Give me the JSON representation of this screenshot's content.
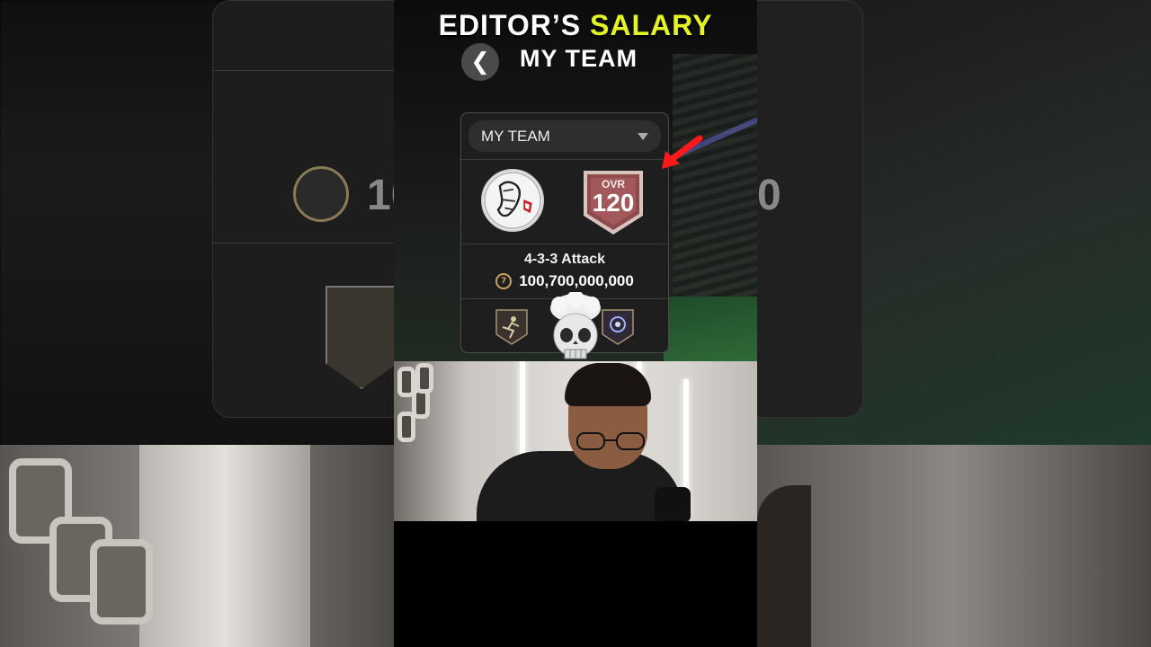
{
  "headline": {
    "part1": "EDITOR’S ",
    "part2": "SALARY"
  },
  "header": {
    "title": "MY TEAM",
    "back_glyph": "❮"
  },
  "card": {
    "dropdown_label": "MY TEAM",
    "ovr_label": "OVR",
    "ovr_value": "120",
    "formation": "4-3-3 Attack",
    "team_value": "100,700,000,000"
  },
  "background": {
    "left_value_fragment": "10",
    "right_value_fragment": "0"
  },
  "colors": {
    "accent_yellow": "#e6f322",
    "ovr_badge_red": "#8e4a4d",
    "arrow_red": "#ff1a1a",
    "coin_gold": "#c6a35c"
  },
  "icons": [
    "back-chevron-icon",
    "dropdown-caret-icon",
    "club-crest-icon",
    "ovr-badge-icon",
    "coin-icon",
    "player-badge-icon",
    "skull-emoji",
    "red-arrow-icon"
  ]
}
